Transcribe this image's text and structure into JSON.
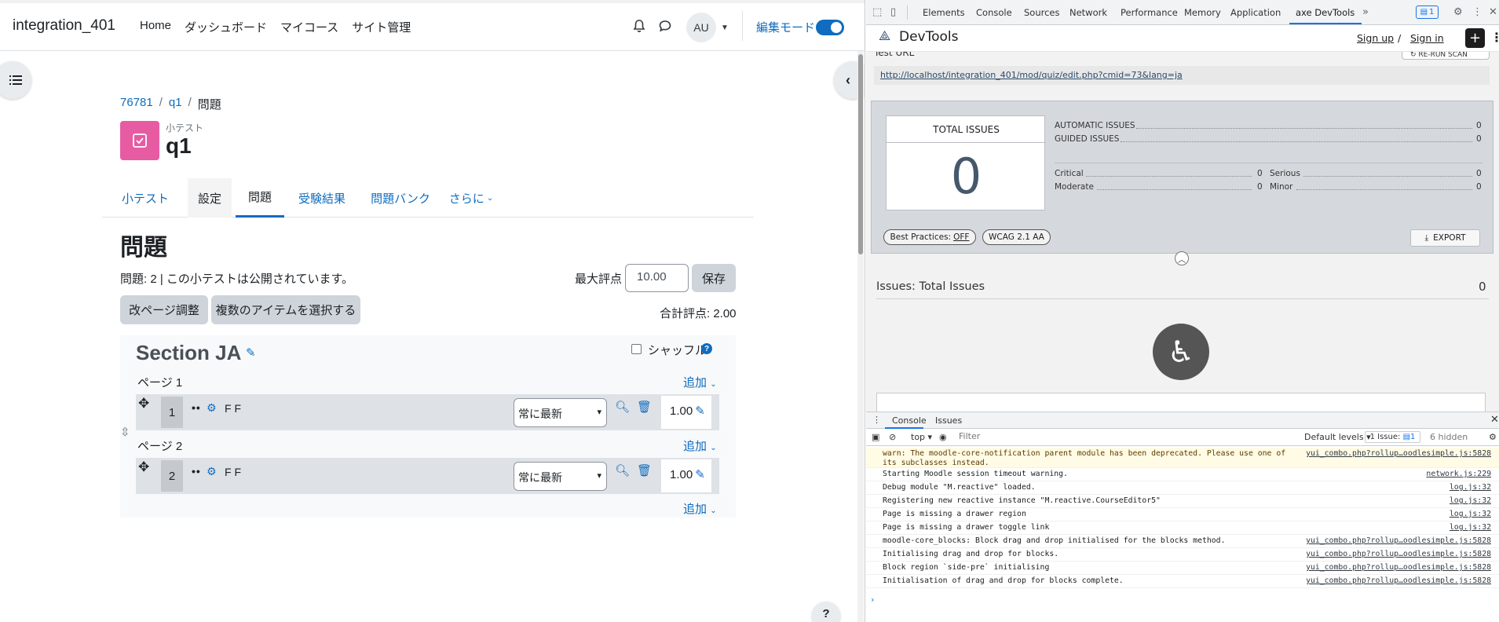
{
  "moodle": {
    "site_name": "integration_401",
    "nav": [
      "Home",
      "ダッシュボード",
      "マイコース",
      "サイト管理"
    ],
    "user_initials": "AU",
    "edit_mode_label": "編集モード",
    "breadcrumb": [
      "76781",
      "q1",
      "問題"
    ],
    "activity_type": "小テスト",
    "activity_name": "q1",
    "tabs": [
      "小テスト",
      "設定",
      "問題",
      "受験結果",
      "問題バンク",
      "さらに"
    ],
    "heading": "問題",
    "questions_info": "問題: 2 | この小テストは公開されています。",
    "max_grade_label": "最大評点",
    "max_grade_value": "10.00",
    "save_label": "保存",
    "repaginate_label": "改ページ調整",
    "select_multiple_label": "複数のアイテムを選択する",
    "total_marks": "合計評点: 2.00",
    "section_title": "Section JA",
    "shuffle_label": "シャッフル",
    "add_label": "追加",
    "pages": [
      {
        "label": "ページ 1",
        "slot": "1",
        "qname": "F F",
        "version": "常に最新",
        "mark": "1.00"
      },
      {
        "label": "ページ 2",
        "slot": "2",
        "qname": "F F",
        "version": "常に最新",
        "mark": "1.00"
      }
    ],
    "help_label": "?"
  },
  "devtools": {
    "tabs": [
      "Elements",
      "Console",
      "Sources",
      "Network",
      "Performance",
      "Memory",
      "Application",
      "axe DevTools"
    ],
    "issues_badge": "1",
    "axe": {
      "title": "DevTools",
      "sign_up": "Sign up",
      "sign_in": "Sign in",
      "test_url_label": "Test URL",
      "rerun_label": "RE-RUN SCAN",
      "url": "http://localhost/integration_401/mod/quiz/edit.php?cmid=73&lang=ja",
      "total_issues_label": "TOTAL ISSUES",
      "total_issues": "0",
      "automatic_label": "AUTOMATIC ISSUES",
      "automatic": "0",
      "guided_label": "GUIDED ISSUES",
      "guided": "0",
      "critical_label": "Critical",
      "critical": "0",
      "serious_label": "Serious",
      "serious": "0",
      "moderate_label": "Moderate",
      "moderate": "0",
      "minor_label": "Minor",
      "minor": "0",
      "best_practices_label": "Best Practices:",
      "best_practices_value": "OFF",
      "wcag_label": "WCAG 2.1 AA",
      "export_label": "EXPORT",
      "issues_title": "Issues: Total Issues",
      "issues_count": "0"
    },
    "console": {
      "tabs": [
        "Console",
        "Issues"
      ],
      "context": "top",
      "filter_placeholder": "Filter",
      "levels": "Default levels",
      "issue_count": "1 Issue:",
      "issue_count_num": "1",
      "hidden": "6 hidden",
      "lines": [
        {
          "msg": "warn: The moodle-core-notification parent module has been deprecated. Please use one of its subclasses instead.",
          "src": "yui_combo.php?rollup…oodlesimple.js:5828",
          "warn": true
        },
        {
          "msg": "Starting Moodle session timeout warning.",
          "src": "network.js:229"
        },
        {
          "msg": "Debug module \"M.reactive\" loaded.",
          "src": "log.js:32"
        },
        {
          "msg": "Registering new reactive instance \"M.reactive.CourseEditor5\"",
          "src": "log.js:32"
        },
        {
          "msg": "Page is missing a drawer region",
          "src": "log.js:32"
        },
        {
          "msg": "Page is missing a drawer toggle link",
          "src": "log.js:32"
        },
        {
          "msg": "moodle-core_blocks: Block drag and drop initialised for the blocks method.",
          "src": "yui_combo.php?rollup…oodlesimple.js:5828"
        },
        {
          "msg": "Initialising drag and drop for blocks.",
          "src": "yui_combo.php?rollup…oodlesimple.js:5828"
        },
        {
          "msg": "Block region `side-pre` initialising",
          "src": "yui_combo.php?rollup…oodlesimple.js:5828"
        },
        {
          "msg": "Initialisation of drag and drop for blocks complete.",
          "src": "yui_combo.php?rollup…oodlesimple.js:5828"
        }
      ]
    }
  }
}
